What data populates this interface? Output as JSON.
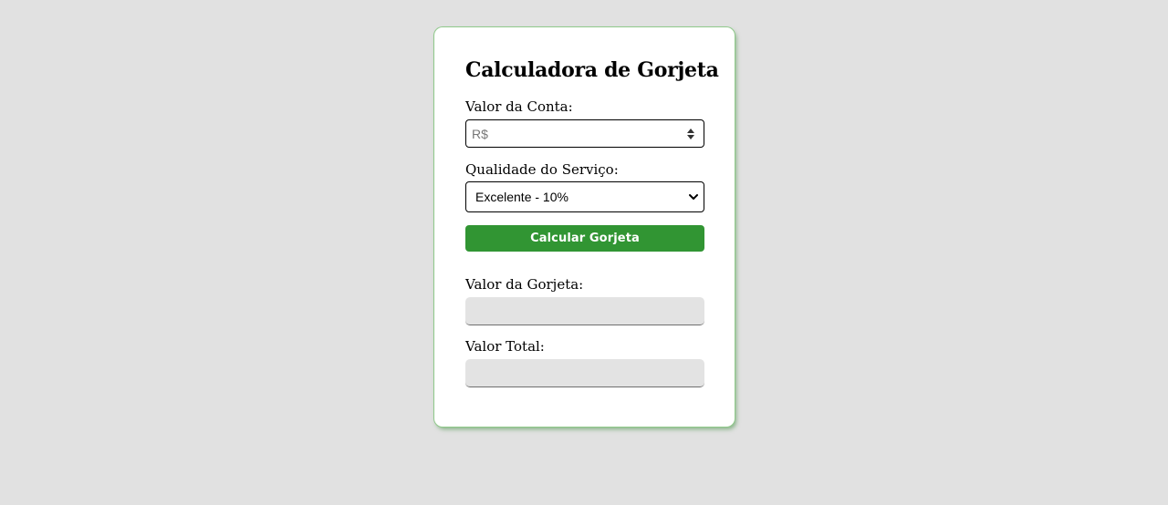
{
  "card": {
    "title": "Calculadora de Gorjeta"
  },
  "bill": {
    "label": "Valor da Conta:",
    "placeholder": "R$",
    "value": ""
  },
  "service": {
    "label": "Qualidade do Serviço:",
    "selected": "Excelente - 10%"
  },
  "actions": {
    "calculate_label": "Calcular Gorjeta"
  },
  "results": {
    "tip_label": "Valor da Gorjeta:",
    "tip_value": "",
    "total_label": "Valor Total:",
    "total_value": ""
  },
  "theme": {
    "accent": "#319533",
    "background": "#e1e1e1",
    "card": "#ffffff",
    "readonly_field": "#e3e3e3"
  }
}
